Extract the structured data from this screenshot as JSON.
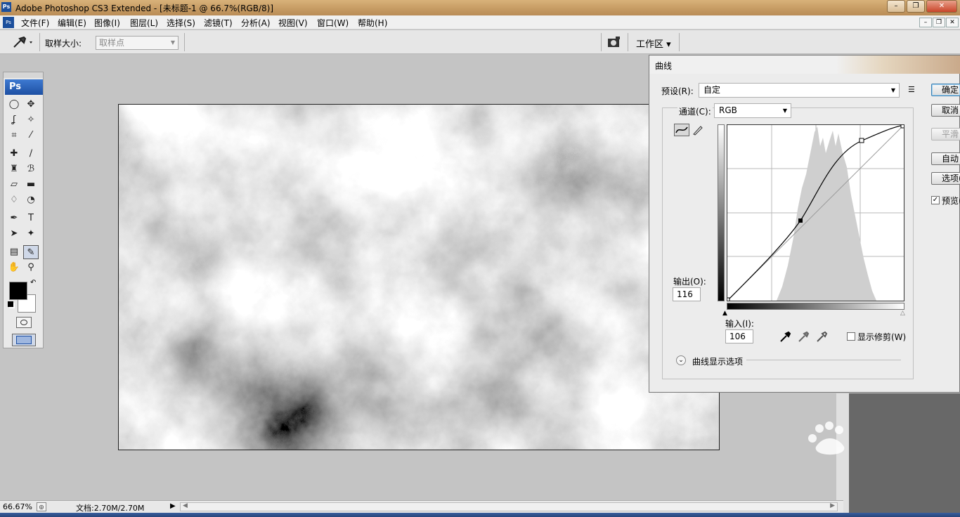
{
  "window": {
    "title": "Adobe Photoshop CS3 Extended - [未标题-1 @ 66.7%(RGB/8)]",
    "app_icon": "Ps",
    "buttons": [
      "minimize-icon",
      "restore-icon",
      "close-icon"
    ],
    "minimize": "–",
    "restore": "❐",
    "close": "✕"
  },
  "menu": {
    "items": [
      "文件(F)",
      "编辑(E)",
      "图像(I)",
      "图层(L)",
      "选择(S)",
      "滤镜(T)",
      "分析(A)",
      "视图(V)",
      "窗口(W)",
      "帮助(H)"
    ],
    "doc_min": "–",
    "doc_restore": "❐",
    "doc_close": "✕",
    "doc_icon": "Ps"
  },
  "options": {
    "sample_size_label": "取样大小:",
    "sample_size_value": "取样点",
    "workspace_label": "工作区 ▾",
    "tool_icon": "eyedropper-icon"
  },
  "toolbox": {
    "logo": "Ps"
  },
  "status": {
    "zoom": "66.67%",
    "doc_info": "文档:2.70M/2.70M"
  },
  "dialog": {
    "title": "曲线",
    "preset_label": "预设(R):",
    "preset_value": "自定",
    "channel_label": "通道(C):",
    "channel_value": "RGB",
    "output_label": "输出(O):",
    "output_value": "116",
    "input_label": "输入(I):",
    "input_value": "106",
    "show_clipping_label": "显示修剪(W)",
    "show_clipping_checked": false,
    "curve_options_label": "曲线显示选项",
    "buttons": {
      "ok": "确定",
      "cancel": "取消",
      "smooth": "平滑",
      "auto": "自动",
      "options": "选项(T)..."
    },
    "preview_label": "预览(P)",
    "preview_checked": true
  },
  "colors": {
    "accent": "#1d4fa3",
    "dialog_bg": "#ececec",
    "canvas_bg": "#c4c4c4"
  }
}
